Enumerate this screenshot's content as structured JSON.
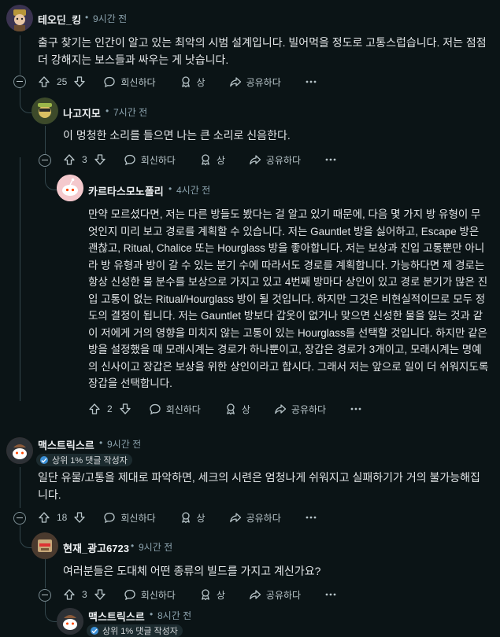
{
  "comments": [
    {
      "author": "테오딘_킹",
      "time": "9시간 전",
      "text": "출구 찾기는 인간이 알고 있는 최악의 시범 설계입니다. 빌어먹을 정도로 고통스럽습니다. 저는 점점 더 강해지는 보스들과 싸우는 게 낫습니다.",
      "votes": "25"
    },
    {
      "author": "나고지모",
      "time": "7시간 전",
      "text": "이 멍청한 소리를 들으면 나는 큰 소리로 신음한다.",
      "votes": "3"
    },
    {
      "author": "카르타스모노폴리",
      "time": "4시간 전",
      "text": "만약 모르셨다면, 저는 다른 방들도 봤다는 걸 알고 있기 때문에, 다음 몇 가지 방 유형이 무엇인지 미리 보고 경로를 계획할 수 있습니다. 저는 Gauntlet 방을 싫어하고, Escape 방은 괜찮고, Ritual, Chalice 또는 Hourglass 방을 좋아합니다. 저는 보상과 진입 고통뿐만 아니라 방 유형과 방이 갈 수 있는 분기 수에 따라서도 경로를 계획합니다. 가능하다면 제 경로는 항상 신성한 물 분수를 보상으로 가지고 있고 4번째 방마다 상인이 있고 경로 분기가 많은 진입 고통이 없는 Ritual/Hourglass 방이 될 것입니다. 하지만 그것은 비현실적이므로 모두 정도의 결정이 됩니다. 저는 Gauntlet 방보다 갑옷이 없거나 맞으면 신성한 물을 잃는 것과 같이 저에게 거의 영향을 미치지 않는 고통이 있는 Hourglass를 선택할 것입니다. 하지만 같은 방을 설정했을 때 모래시계는 경로가 하나뿐이고, 장갑은 경로가 3개이고, 모래시계는 명예의 신사이고 장갑은 보상을 위한 상인이라고 합시다. 그래서 저는 앞으로 일이 더 쉬워지도록 장갑을 선택합니다.",
      "votes": "2"
    },
    {
      "author": "맥스트릭스르",
      "time": "9시간 전",
      "flair": "상위 1% 댓글 작성자",
      "text": "일단 유물/고통을 제대로 파악하면, 세크의 시련은 엄청나게 쉬워지고 실패하기가 거의 불가능해집니다.",
      "votes": "18"
    },
    {
      "author": "현재_광고6723",
      "time": "9시간 전",
      "text": "여러분들은 도대체 어떤 종류의 빌드를 가지고 계신가요?",
      "votes": "3"
    },
    {
      "author": "맥스트릭스르",
      "time": "8시간 전",
      "flair": "상위 1% 댓글 작성자"
    }
  ],
  "labels": {
    "reply": "회신하다",
    "award": "상",
    "share": "공유하다"
  },
  "icons": [
    "upvote-icon",
    "downvote-icon",
    "reply-bubble-icon",
    "award-icon",
    "share-icon",
    "more-icon",
    "collapse-icon",
    "flair-icon"
  ],
  "colors": {
    "background": "#0b1416",
    "text": "#d7dadc",
    "meta": "#8ba2ad",
    "thread": "#33464c"
  }
}
